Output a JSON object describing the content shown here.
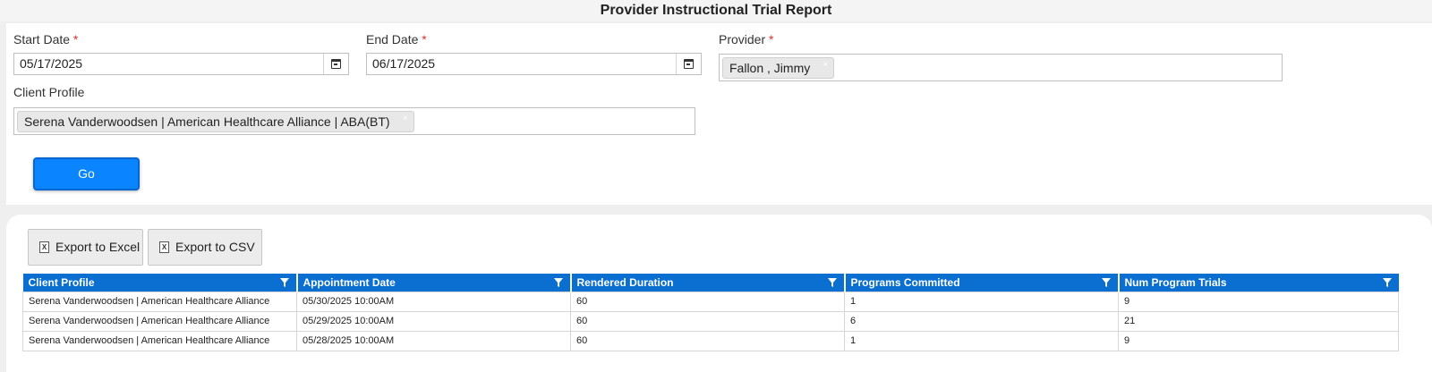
{
  "page_title": "Provider Instructional Trial Report",
  "filters": {
    "start_date": {
      "label": "Start Date",
      "required_mark": "*",
      "value": "05/17/2025"
    },
    "end_date": {
      "label": "End Date",
      "required_mark": "*",
      "value": "06/17/2025"
    },
    "provider": {
      "label": "Provider",
      "required_mark": "*",
      "selected": "Fallon , Jimmy"
    },
    "client_profile": {
      "label": "Client Profile",
      "selected": "Serena Vanderwoodsen | American Healthcare Alliance | ABA(BT)"
    },
    "remove_tag_glyph": "×",
    "go_label": "Go"
  },
  "toolbar": {
    "export_excel_label": "Export to Excel",
    "export_csv_label": "Export to CSV",
    "file_icon_glyph": "X"
  },
  "grid": {
    "columns": [
      "Client Profile",
      "Appointment Date",
      "Rendered Duration",
      "Programs Committed",
      "Num Program Trials"
    ],
    "rows": [
      [
        "Serena Vanderwoodsen | American Healthcare Alliance",
        "05/30/2025 10:00AM",
        "60",
        "1",
        "9"
      ],
      [
        "Serena Vanderwoodsen | American Healthcare Alliance",
        "05/29/2025 10:00AM",
        "60",
        "6",
        "21"
      ],
      [
        "Serena Vanderwoodsen | American Healthcare Alliance",
        "05/28/2025 10:00AM",
        "60",
        "1",
        "9"
      ]
    ]
  },
  "colors": {
    "header_blue": "#0a6fd1",
    "go_button_blue": "#0a84ff",
    "required_red": "#e03030"
  }
}
